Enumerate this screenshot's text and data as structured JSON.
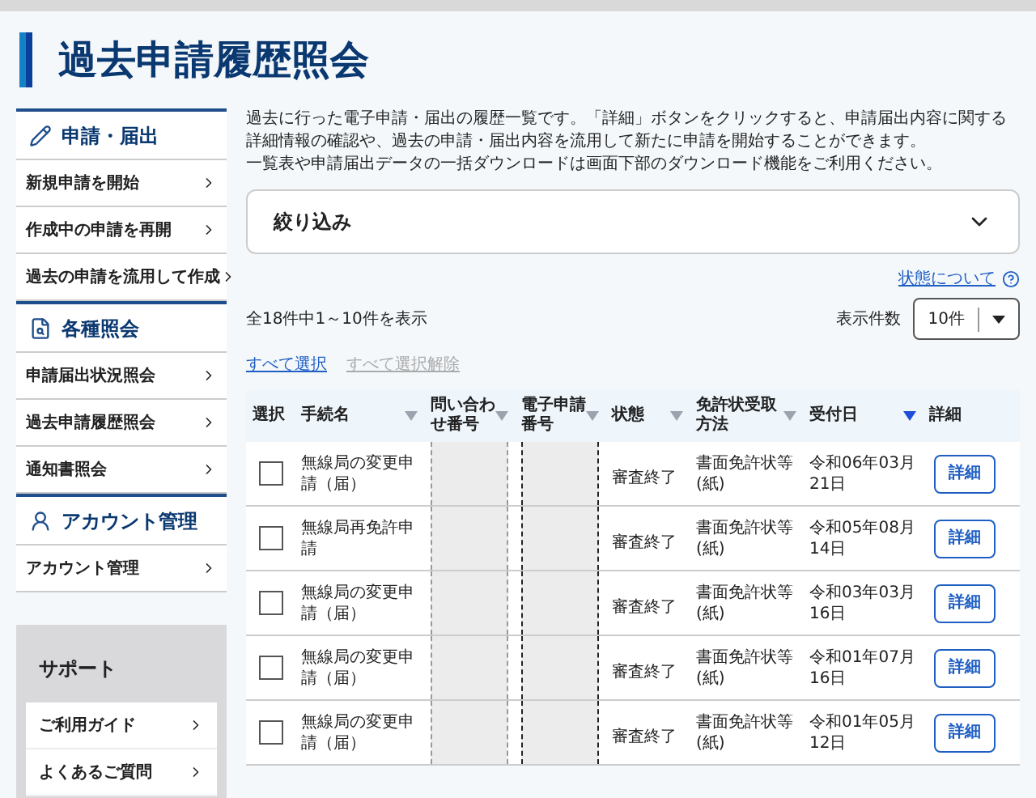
{
  "page_title": "過去申請履歴照会",
  "sidebar": {
    "sections": [
      {
        "kind": "pen",
        "title": "申請・届出",
        "items": [
          "新規申請を開始",
          "作成中の申請を再開",
          "過去の申請を流用して作成"
        ]
      },
      {
        "kind": "search",
        "title": "各種照会",
        "items": [
          "申請届出状況照会",
          "過去申請履歴照会",
          "通知書照会"
        ]
      },
      {
        "kind": "person",
        "title": "アカウント管理",
        "items": [
          "アカウント管理"
        ]
      }
    ],
    "support": {
      "title": "サポート",
      "items": [
        "ご利用ガイド",
        "よくあるご質問"
      ]
    }
  },
  "description": [
    "過去に行った電子申請・届出の履歴一覧です。「詳細」ボタンをクリックすると、申請届出内容に関する詳細情報の確認や、過去の申請・届出内容を流用して新たに申請を開始することができます。",
    "一覧表や申請届出データの一括ダウンロードは画面下部のダウンロード機能をご利用ください。"
  ],
  "filter": {
    "label": "絞り込み",
    "expanded": false
  },
  "status_help_link": "状態について",
  "result_count": "全18件中1～10件を表示",
  "page_size": {
    "label": "表示件数",
    "value": "10件"
  },
  "bulk_actions": [
    {
      "label": "すべて選択",
      "disabled": false
    },
    {
      "label": "すべて選択解除",
      "disabled": true
    }
  ],
  "table": {
    "columns": [
      {
        "label": "選択",
        "sortable": false
      },
      {
        "label": "手続名",
        "sortable": true,
        "sorted": false
      },
      {
        "label": "問い合わせ番号",
        "sortable": true,
        "sorted": false
      },
      {
        "label": "電子申請番号",
        "sortable": true,
        "sorted": false
      },
      {
        "label": "状態",
        "sortable": true,
        "sorted": false
      },
      {
        "label": "免許状受取方法",
        "sortable": true,
        "sorted": false
      },
      {
        "label": "受付日",
        "sortable": true,
        "sorted": true
      },
      {
        "label": "詳細",
        "sortable": false
      }
    ],
    "rows": [
      {
        "checked": false,
        "procedure": "無線局の変更申請（届）",
        "status": "審査終了",
        "receipt_method": "書面免許状等(紙)",
        "date": "令和06年03月21日",
        "button": "詳細"
      },
      {
        "checked": false,
        "procedure": "無線局再免許申請",
        "status": "審査終了",
        "receipt_method": "書面免許状等(紙)",
        "date": "令和05年08月14日",
        "button": "詳細"
      },
      {
        "checked": false,
        "procedure": "無線局の変更申請（届）",
        "status": "審査終了",
        "receipt_method": "書面免許状等(紙)",
        "date": "令和03年03月16日",
        "button": "詳細"
      },
      {
        "checked": false,
        "procedure": "無線局の変更申請（届）",
        "status": "審査終了",
        "receipt_method": "書面免許状等(紙)",
        "date": "令和01年07月16日",
        "button": "詳細"
      },
      {
        "checked": false,
        "procedure": "無線局の変更申請（届）",
        "status": "審査終了",
        "receipt_method": "書面免許状等(紙)",
        "date": "令和01年05月12日",
        "button": "詳細"
      }
    ]
  }
}
